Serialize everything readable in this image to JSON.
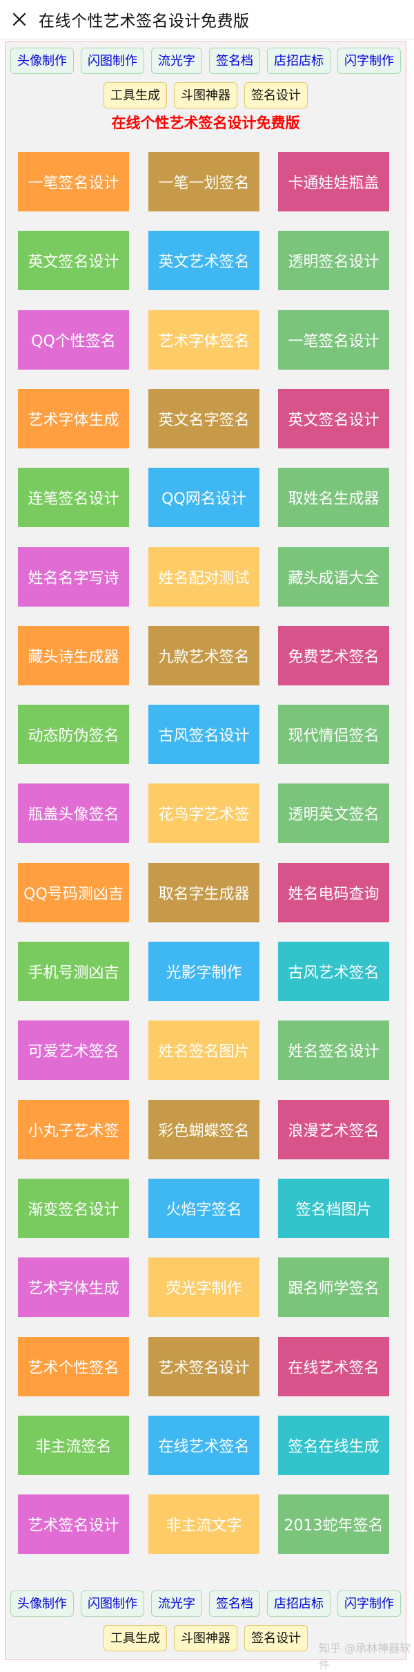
{
  "window": {
    "title": "在线个性艺术签名设计免费版",
    "close_icon": "close-icon"
  },
  "nav": {
    "row1": [
      "头像制作",
      "闪图制作",
      "流光字",
      "签名档",
      "店招店标",
      "闪字制作"
    ],
    "row2": [
      "工具生成",
      "斗图神器",
      "签名设计"
    ]
  },
  "headline": "在线个性艺术签名设计免费版",
  "colors": {
    "orange": "#ff9f3f",
    "gold": "#c69a48",
    "pink": "#d9538b",
    "green": "#7acb5f",
    "sky": "#3fb7f3",
    "teal": "#7ac47b",
    "magenta": "#e06cd4",
    "yellow": "#fecc67",
    "cyan": "#33c3cb",
    "link": "#0000dd",
    "headline": "#ff0000"
  },
  "tiles": [
    [
      "一笔签名设计",
      "一笔一划签名",
      "卡通娃娃瓶盖"
    ],
    [
      "英文签名设计",
      "英文艺术签名",
      "透明签名设计"
    ],
    [
      "QQ个性签名",
      "艺术字体签名",
      "一笔签名设计"
    ],
    [
      "艺术字体生成",
      "英文名字签名",
      "英文签名设计"
    ],
    [
      "连笔签名设计",
      "QQ网名设计",
      "取姓名生成器"
    ],
    [
      "姓名名字写诗",
      "姓名配对测试",
      "藏头成语大全"
    ],
    [
      "藏头诗生成器",
      "九款艺术签名",
      "免费艺术签名"
    ],
    [
      "动态防伪签名",
      "古风签名设计",
      "现代情侣签名"
    ],
    [
      "瓶盖头像签名",
      "花鸟字艺术签",
      "透明英文签名"
    ],
    [
      "QQ号码测凶吉",
      "取名字生成器",
      "姓名电码查询"
    ],
    [
      "手机号测凶吉",
      "光影字制作",
      "古风艺术签名"
    ],
    [
      "可爱艺术签名",
      "姓名签名图片",
      "姓名签名设计"
    ],
    [
      "小丸子艺术签",
      "彩色蝴蝶签名",
      "浪漫艺术签名"
    ],
    [
      "渐变签名设计",
      "火焰字签名",
      "签名档图片"
    ],
    [
      "艺术字体生成",
      "荧光字制作",
      "跟名师学签名"
    ],
    [
      "艺术个性签名",
      "艺术签名设计",
      "在线艺术签名"
    ],
    [
      "非主流签名",
      "在线艺术签名",
      "签名在线生成"
    ],
    [
      "艺术签名设计",
      "非主流文字",
      "2013蛇年签名"
    ]
  ],
  "tile_colors": [
    [
      "orange",
      "gold",
      "pink"
    ],
    [
      "green",
      "sky",
      "teal"
    ],
    [
      "magenta",
      "yellow",
      "teal"
    ],
    [
      "orange",
      "gold",
      "pink"
    ],
    [
      "green",
      "sky",
      "teal"
    ],
    [
      "magenta",
      "yellow",
      "teal"
    ],
    [
      "orange",
      "gold",
      "pink"
    ],
    [
      "green",
      "sky",
      "teal"
    ],
    [
      "magenta",
      "yellow",
      "teal"
    ],
    [
      "orange",
      "gold",
      "pink"
    ],
    [
      "green",
      "sky",
      "cyan"
    ],
    [
      "magenta",
      "yellow",
      "teal"
    ],
    [
      "orange",
      "gold",
      "pink"
    ],
    [
      "green",
      "sky",
      "cyan"
    ],
    [
      "magenta",
      "yellow",
      "teal"
    ],
    [
      "orange",
      "gold",
      "pink"
    ],
    [
      "green",
      "sky",
      "cyan"
    ],
    [
      "magenta",
      "yellow",
      "teal"
    ]
  ],
  "watermark": "知乎 @承林神器软件"
}
